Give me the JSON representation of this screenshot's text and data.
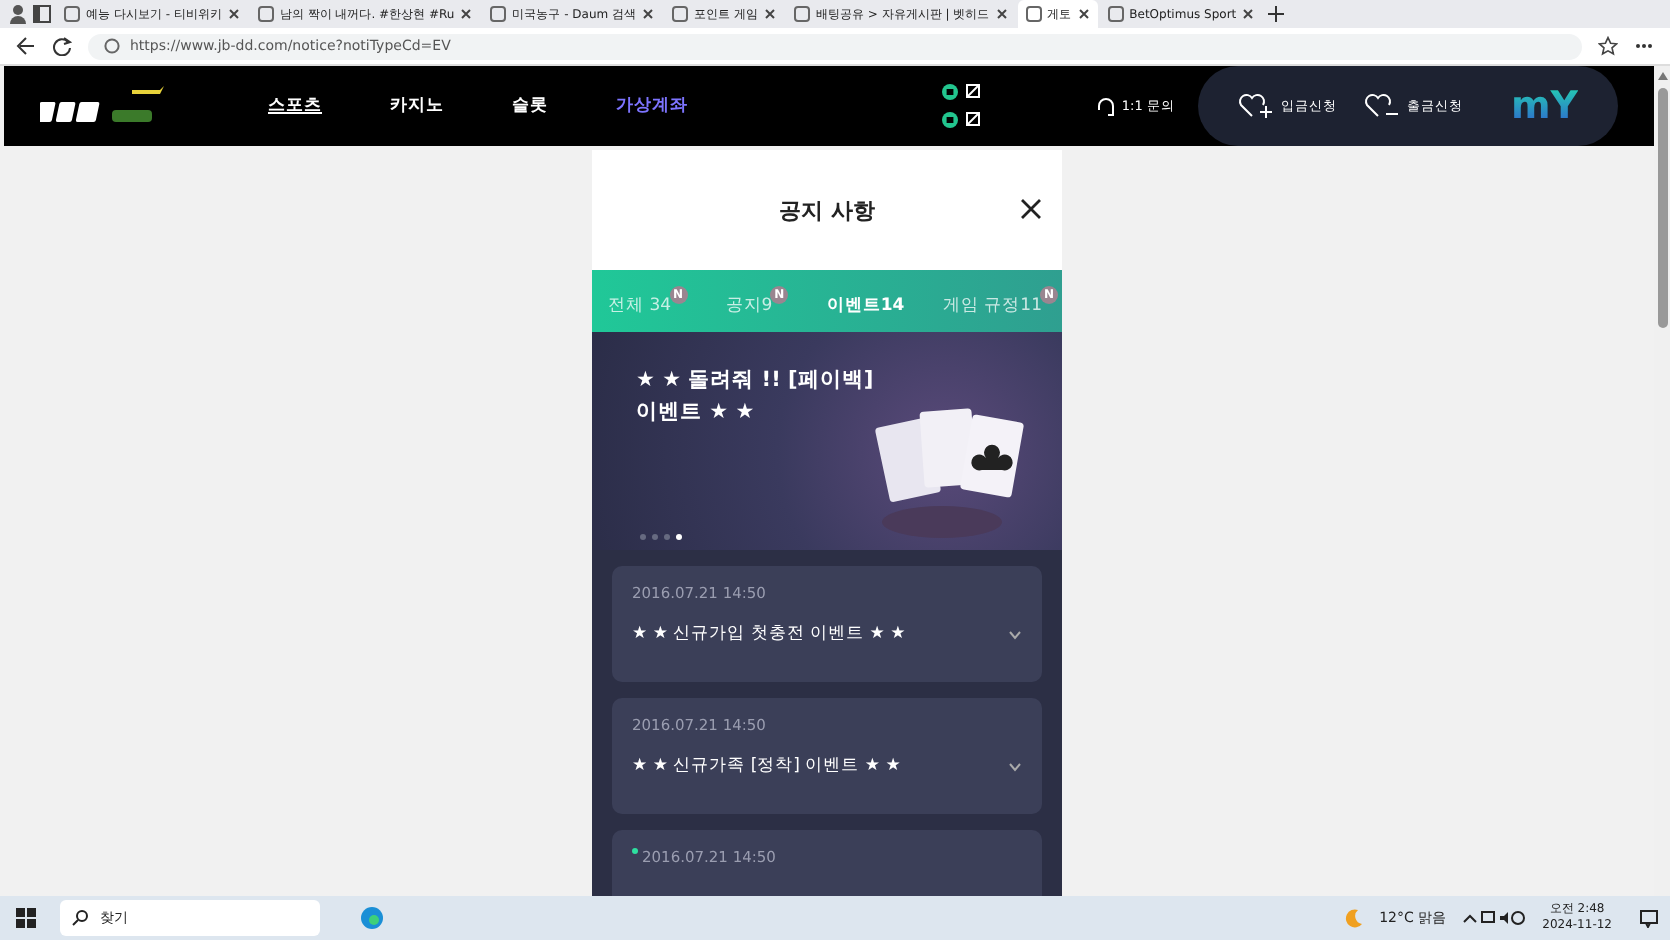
{
  "browser": {
    "tabs": [
      {
        "title": "예능 다시보기 - 티비위키",
        "selected": false
      },
      {
        "title": "남의 짝이 내꺼다. #한상현 #Ru",
        "selected": false
      },
      {
        "title": "미국농구 - Daum 검색",
        "selected": false
      },
      {
        "title": "포인트 게임",
        "selected": false
      },
      {
        "title": "배팅공유 > 자유게시판 | 벳히드",
        "selected": false
      },
      {
        "title": "게토",
        "selected": true
      },
      {
        "title": "BetOptimus Sport",
        "selected": false
      }
    ],
    "address": "https://www.jb-dd.com/notice?notiTypeCd=EV"
  },
  "header": {
    "nav": [
      {
        "label": "스포츠",
        "selected": true,
        "highlight": false
      },
      {
        "label": "카지노",
        "selected": false,
        "highlight": false
      },
      {
        "label": "슬롯",
        "selected": false,
        "highlight": false
      },
      {
        "label": "가상계좌",
        "selected": false,
        "highlight": true
      }
    ],
    "support": "1:1 문의",
    "deposit": "입금신청",
    "withdraw": "출금신청",
    "my": "mY"
  },
  "modal": {
    "title": "공지 사항",
    "tabs": [
      {
        "label": "전체 34",
        "selected": false,
        "badge": "N"
      },
      {
        "label": "공지9",
        "selected": false,
        "badge": "N"
      },
      {
        "label": "이벤트14",
        "selected": true
      },
      {
        "label": "게임 규정11",
        "selected": false,
        "badge": "N"
      }
    ],
    "banner": {
      "title": "★ ★ 돌려줘 !! [페이백] 이벤트 ★ ★"
    },
    "dots": [
      {
        "selected": false
      },
      {
        "selected": false
      },
      {
        "selected": false
      },
      {
        "selected": true
      }
    ],
    "notices": [
      {
        "date": "2016.07.21 14:50",
        "title": "★ ★ 신규가입 첫충전 이벤트 ★ ★",
        "expanded": false,
        "new": false
      },
      {
        "date": "2016.07.21 14:50",
        "title": "★ ★ 신규가족 [정착] 이벤트 ★ ★",
        "expanded": false,
        "new": false
      },
      {
        "date": "2016.07.21 14:50",
        "new": true
      }
    ]
  },
  "taskbar": {
    "search": "찾기",
    "weather": "12°C 맑음",
    "time": "오전 2:48",
    "date": "2024-11-12"
  }
}
